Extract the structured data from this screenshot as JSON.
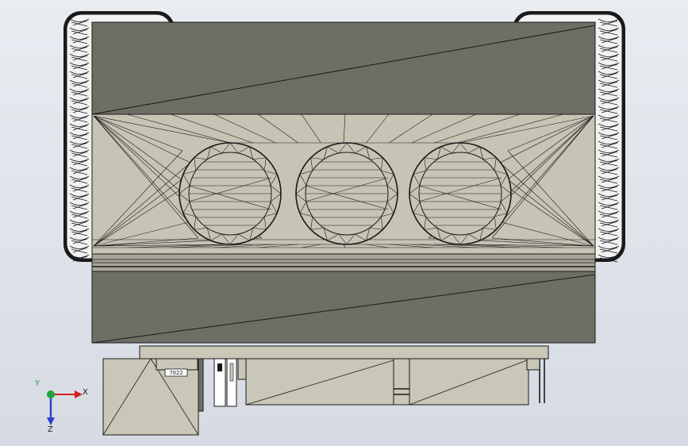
{
  "view": {
    "background": [
      "#e9ecf1",
      "#d6dbe3"
    ],
    "mesh_color": "#1a1a1a"
  },
  "model": {
    "colors": {
      "top_face": "#6f6e64",
      "front_face": "#c6c4b4",
      "band": "#a7a597",
      "lower_face": "#6f6e64",
      "parts": "#c9c7b7",
      "tread": "#f2f2f2",
      "edge": "#1a1a1a"
    },
    "small_label": "7022"
  },
  "triad": {
    "x_label": "X",
    "y_label": "Y",
    "z_label": "Z",
    "x_color": "#d81f1f",
    "y_color": "#19a53a",
    "z_color": "#2b3fd1"
  }
}
